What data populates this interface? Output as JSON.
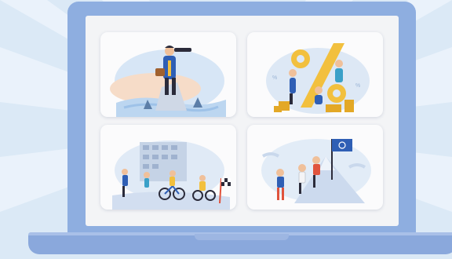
{
  "illustration": {
    "colors": {
      "background": "#dbe9f6",
      "laptop": "#8eaee0",
      "screen": "#f3f4f6",
      "accent_blue": "#2f5fb5",
      "accent_yellow": "#f2c03e",
      "accent_red": "#e0533d"
    },
    "cards": [
      {
        "name": "lookout-businessman",
        "icons": [
          "telescope-icon",
          "shark-fin-icon"
        ]
      },
      {
        "name": "percent-team",
        "icons": [
          "percent-sign-icon",
          "coin-stack-icon"
        ]
      },
      {
        "name": "race-to-finish",
        "icons": [
          "bicycle-icon",
          "finish-flag-icon"
        ]
      },
      {
        "name": "summit-teamwork",
        "icons": [
          "flag-icon",
          "mountain-icon"
        ]
      }
    ]
  }
}
